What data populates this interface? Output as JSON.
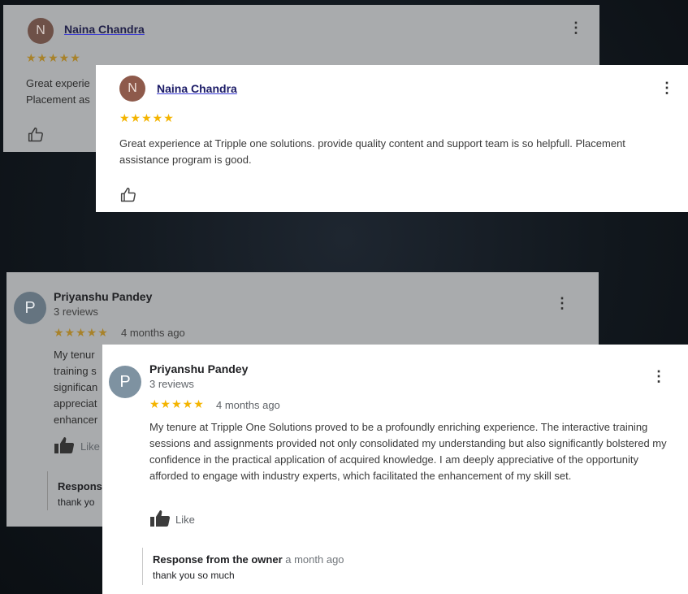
{
  "review1": {
    "avatar_letter": "N",
    "name": "Naina Chandra",
    "stars": "★★★★★",
    "text": "Great experience at Tripple one solutions. provide quality content and support team is so helpfull. Placement assistance program is good.",
    "ghost_line1": "Great experie",
    "ghost_line2": "Placement as",
    "menu_icon": "more-vert-icon",
    "like_icon": "thumb-up-outline-icon"
  },
  "review2": {
    "avatar_letter": "P",
    "name": "Priyanshu Pandey",
    "review_count": "3 reviews",
    "stars": "★★★★★",
    "time": "4 months ago",
    "text": "My tenure at Tripple One Solutions proved to be a profoundly enriching experience. The interactive training sessions and assignments provided not only consolidated my understanding but also significantly bolstered my confidence in the practical application of acquired knowledge. I am deeply appreciative of the opportunity afforded to engage with industry experts, which facilitated the enhancement of my skill set.",
    "ghost_lines": [
      "My tenur",
      "training s",
      "significan",
      "appreciat",
      "enhancer"
    ],
    "like_label": "Like",
    "ghost_like_label": "Like",
    "response_title": "Response from the owner",
    "response_time": "a month ago",
    "response_text": "thank you so much",
    "ghost_response_title": "Respons",
    "ghost_response_text": "thank yo",
    "menu_icon": "more-vert-icon",
    "like_icon": "thumb-up-filled-icon"
  },
  "colors": {
    "star": "#f4b400",
    "name_link": "#1a1a66",
    "avatar_n": "#8e5a4b",
    "avatar_p": "#7e92a1",
    "background": "#11171d"
  }
}
